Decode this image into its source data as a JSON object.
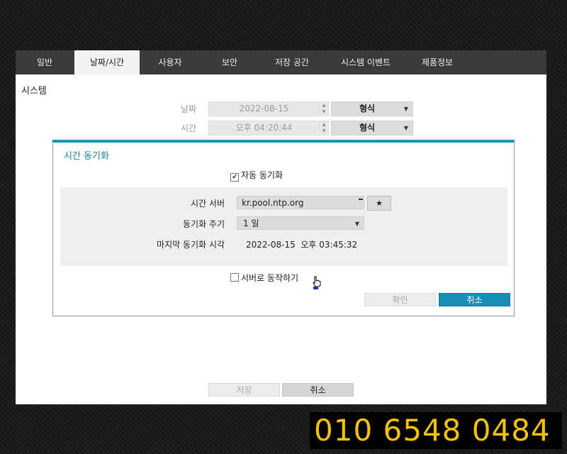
{
  "tabs": [
    {
      "label": "일반",
      "active": false
    },
    {
      "label": "날짜/시간",
      "active": true
    },
    {
      "label": "사용자",
      "active": false
    },
    {
      "label": "보안",
      "active": false
    },
    {
      "label": "저장 공간",
      "active": false
    },
    {
      "label": "시스템 이벤트",
      "active": false
    },
    {
      "label": "제품정보",
      "active": false
    }
  ],
  "system": {
    "title": "시스템",
    "date_label": "날짜",
    "date_value": "2022-08-15",
    "date_format": "형식",
    "time_label": "시간",
    "time_value": "오후 04:20:44",
    "time_format": "형식"
  },
  "dialog": {
    "title": "시간 동기화",
    "auto_sync_label": "자동 동기화",
    "auto_sync_checked": true,
    "server_label": "시간 서버",
    "server_value": "kr.pool.ntp.org",
    "server_button_icon": "star-icon",
    "server_button_glyph": "★",
    "interval_label": "동기화 주기",
    "interval_value": "1 일",
    "last_sync_label": "마지막 동기화 시각",
    "last_sync_value": "2022-08-15  오후 03:45:32",
    "server_mode_label": "서버로 동작하기",
    "server_mode_checked": false,
    "ok_label": "확인",
    "cancel_label": "취소"
  },
  "footer": {
    "save_label": "저장",
    "cancel_label": "취소"
  },
  "overlay": {
    "phone": "010 6548 0484"
  },
  "colors": {
    "accent": "#1a8fb6",
    "tabbar": "#3a3a3a",
    "phone_text": "#f7c200"
  }
}
